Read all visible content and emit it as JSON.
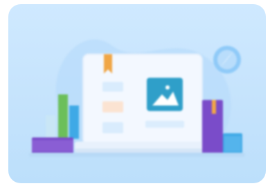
{
  "illustration": {
    "label": "",
    "icons": [
      "laptop-icon",
      "image-icon",
      "bookmark-icon",
      "compass-icon",
      "book-icon"
    ]
  },
  "colors": {
    "card_background": "#cfe9ff",
    "laptop_body": "#f4f9ff",
    "image_tile": "#2f9fc9",
    "bookmark": "#f0a646",
    "book_purple": "#7a4cc9",
    "book_green": "#6cbf5a",
    "book_blue": "#3fa9e6",
    "compass": "#4aa6f0"
  }
}
